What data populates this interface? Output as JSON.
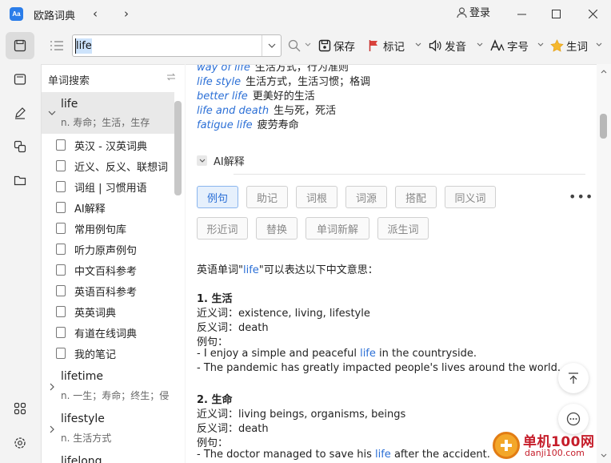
{
  "app": {
    "title": "欧路词典",
    "logo_text": "Aa",
    "login_label": "登录"
  },
  "toolbar": {
    "search_value": "life",
    "save_label": "保存",
    "mark_label": "标记",
    "speak_label": "发音",
    "font_label": "字号",
    "vocab_label": "生词"
  },
  "wordlist": {
    "title": "单词搜索",
    "entries": [
      {
        "word": "life",
        "gloss": "n. 寿命；生活，生存"
      },
      {
        "word": "lifetime",
        "gloss": "n. 一生；寿命；终生；侵"
      },
      {
        "word": "lifestyle",
        "gloss": "n. 生活方式"
      },
      {
        "word": "lifelong",
        "gloss": ""
      }
    ],
    "dictionaries": [
      "英汉 - 汉英词典",
      "近义、反义、联想词",
      "词组 | 习惯用语",
      "AI解释",
      "常用例句库",
      "听力原声例句",
      "中文百科参考",
      "英语百科参考",
      "英英词典",
      "有道在线词典",
      "我的笔记"
    ]
  },
  "content": {
    "phrases": [
      {
        "en": "way of life",
        "zh": "生活方式，行为准则"
      },
      {
        "en": "life style",
        "zh": "生活方式，生活习惯；格调"
      },
      {
        "en": "better life",
        "zh": "更美好的生活"
      },
      {
        "en": "life and death",
        "zh": "生与死，死活"
      },
      {
        "en": "fatigue life",
        "zh": "疲劳寿命"
      }
    ],
    "ai_section_label": "AI解释",
    "tabs_row1": [
      "例句",
      "助记",
      "词根",
      "词源",
      "搭配",
      "同义词"
    ],
    "tabs_row2": [
      "形近词",
      "替换",
      "单词新解",
      "派生词"
    ],
    "more_label": "•••",
    "intro_prefix": "英语单词\"",
    "intro_word": "life",
    "intro_suffix": "\"可以表达以下中文意思：",
    "senses": [
      {
        "heading": "1. 生活",
        "synonyms": "近义词：existence, living, lifestyle",
        "antonyms": "反义词：death",
        "examples_label": "例句：",
        "ex1_pre": "- I enjoy a simple and peaceful ",
        "ex1_word": "life",
        "ex1_post": " in the countryside.",
        "ex2": "- The pandemic has greatly impacted people's lives around the world."
      },
      {
        "heading": "2. 生命",
        "synonyms": "近义词：living beings, organisms, beings",
        "antonyms": "反义词：death",
        "examples_label": "例句：",
        "ex1_pre": "- The doctor managed to save his ",
        "ex1_word": "life",
        "ex1_post": " after the accident."
      }
    ]
  },
  "watermark": {
    "title": "单机100网",
    "url": "danji100.com"
  },
  "colors": {
    "accent": "#2b6fd6",
    "selected_row": "#e9e9e9"
  }
}
